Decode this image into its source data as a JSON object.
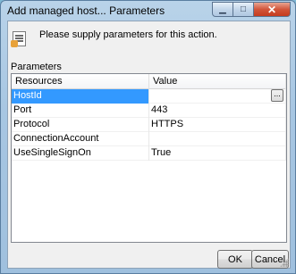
{
  "window": {
    "title": "Add managed host... Parameters",
    "caption_buttons": [
      {
        "name": "minimize-button",
        "glyph": "▁"
      },
      {
        "name": "maximize-button",
        "glyph": "□"
      },
      {
        "name": "close-button",
        "glyph": "✕"
      }
    ]
  },
  "header": {
    "icon": "document-parameters-icon",
    "text": "Please supply parameters for this action."
  },
  "parameters": {
    "label": "Parameters",
    "columns": [
      "Resources",
      "Value"
    ],
    "rows": [
      {
        "resource": "HostId",
        "value": "",
        "selected": true
      },
      {
        "resource": "Port",
        "value": "443"
      },
      {
        "resource": "Protocol",
        "value": "HTTPS"
      },
      {
        "resource": "ConnectionAccount",
        "value": ""
      },
      {
        "resource": "UseSingleSignOn",
        "value": "True"
      }
    ],
    "browse_button": "..."
  },
  "footer": {
    "ok_label": "OK",
    "cancel_label": "Cancel"
  }
}
